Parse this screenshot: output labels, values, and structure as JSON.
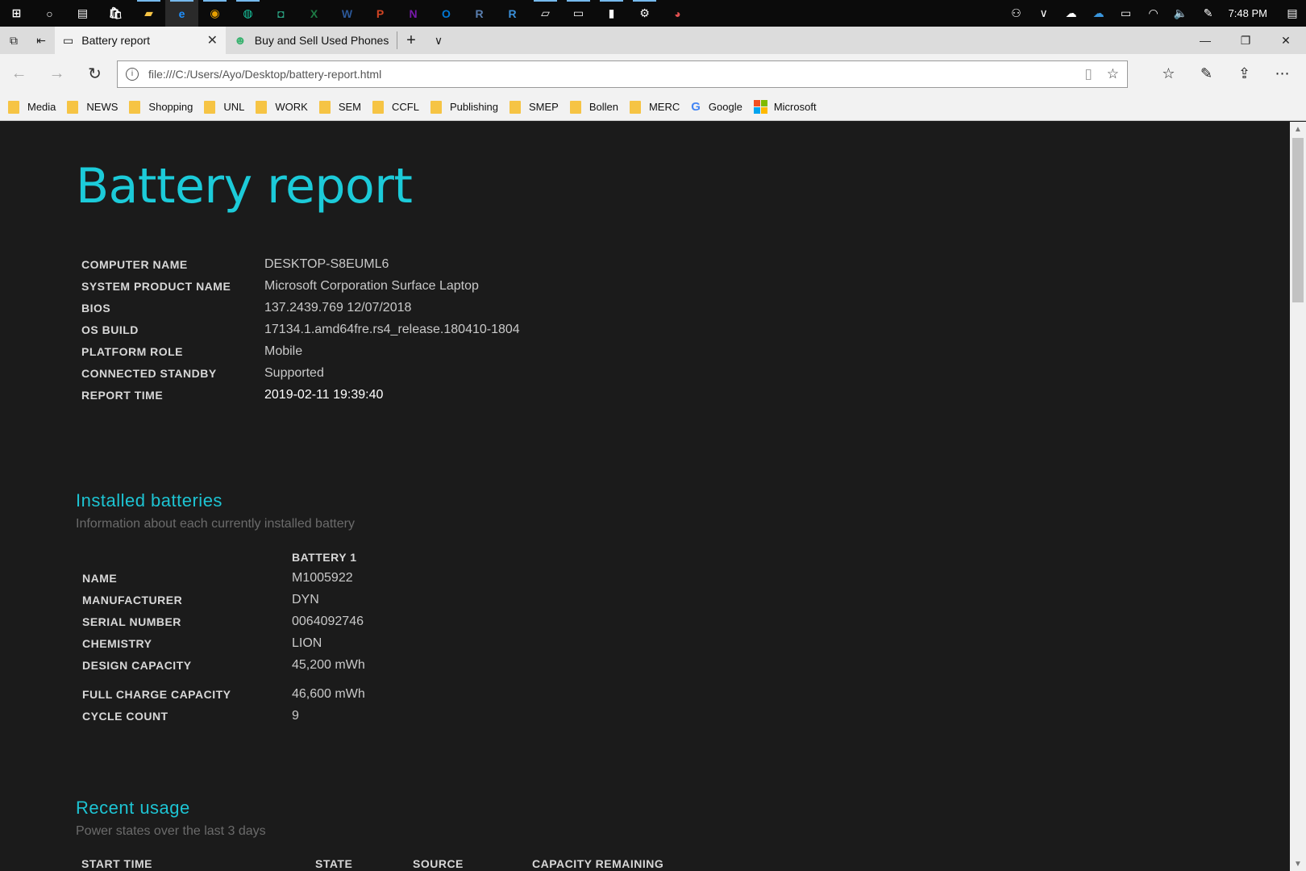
{
  "taskbar": {
    "clock": "7:48 PM",
    "apps": [
      {
        "name": "start-icon",
        "glyph": "⊞",
        "color": "#ffffff"
      },
      {
        "name": "cortana-icon",
        "glyph": "○",
        "color": "#ffffff"
      },
      {
        "name": "task-view-icon",
        "glyph": "▤",
        "color": "#ffffff"
      },
      {
        "name": "store-icon",
        "glyph": "🛍",
        "color": "#ffffff"
      },
      {
        "name": "file-explorer-icon",
        "glyph": "▰",
        "color": "#f6c444"
      },
      {
        "name": "edge-icon",
        "glyph": "e",
        "color": "#1e90ff"
      },
      {
        "name": "chrome-icon",
        "glyph": "◉",
        "color": "#e8a000"
      },
      {
        "name": "globe-app-icon",
        "glyph": "◍",
        "color": "#17c7a0"
      },
      {
        "name": "app-icon",
        "glyph": "◘",
        "color": "#2aa080"
      },
      {
        "name": "excel-icon",
        "glyph": "X",
        "color": "#1d7a44"
      },
      {
        "name": "word-icon",
        "glyph": "W",
        "color": "#2b5797"
      },
      {
        "name": "powerpoint-icon",
        "glyph": "P",
        "color": "#d04423"
      },
      {
        "name": "onenote-icon",
        "glyph": "N",
        "color": "#7719aa"
      },
      {
        "name": "outlook-icon",
        "glyph": "O",
        "color": "#0078d4"
      },
      {
        "name": "r-icon",
        "glyph": "R",
        "color": "#5a7fb0"
      },
      {
        "name": "rstudio-icon",
        "glyph": "R",
        "color": "#3a8fd8"
      },
      {
        "name": "tablet-icon",
        "glyph": "▱",
        "color": "#ffffff"
      },
      {
        "name": "terminal-icon",
        "glyph": "▭",
        "color": "#ffffff"
      },
      {
        "name": "usb-icon",
        "glyph": "▮",
        "color": "#ffffff"
      },
      {
        "name": "settings-icon",
        "glyph": "⚙",
        "color": "#ffffff"
      },
      {
        "name": "paint-icon",
        "glyph": "◕",
        "color": "#e05050"
      }
    ],
    "tray": [
      {
        "name": "people-icon",
        "glyph": "⚇"
      },
      {
        "name": "chevron-up-icon",
        "glyph": "∨"
      },
      {
        "name": "onedrive-white-icon",
        "glyph": "☁"
      },
      {
        "name": "onedrive-blue-icon",
        "glyph": "☁"
      },
      {
        "name": "battery-icon",
        "glyph": "▭"
      },
      {
        "name": "wifi-icon",
        "glyph": "◠"
      },
      {
        "name": "volume-icon",
        "glyph": "🔈"
      },
      {
        "name": "pen-icon",
        "glyph": "✎"
      }
    ],
    "notification_glyph": "▤"
  },
  "tabs": [
    {
      "label": "Battery report",
      "active": true
    },
    {
      "label": "Buy and Sell Used Phones, I",
      "active": false
    }
  ],
  "address": {
    "url": "file:///C:/Users/Ayo/Desktop/battery-report.html"
  },
  "bookmarks": [
    {
      "label": "Media",
      "type": "folder"
    },
    {
      "label": "NEWS",
      "type": "folder"
    },
    {
      "label": "Shopping",
      "type": "folder"
    },
    {
      "label": "UNL",
      "type": "folder"
    },
    {
      "label": "WORK",
      "type": "folder"
    },
    {
      "label": "SEM",
      "type": "folder"
    },
    {
      "label": "CCFL",
      "type": "folder"
    },
    {
      "label": "Publishing",
      "type": "folder"
    },
    {
      "label": "SMEP",
      "type": "folder"
    },
    {
      "label": "Bollen",
      "type": "folder"
    },
    {
      "label": "MERC",
      "type": "folder"
    },
    {
      "label": "Google",
      "type": "google"
    },
    {
      "label": "Microsoft",
      "type": "microsoft"
    }
  ],
  "report": {
    "title": "Battery report",
    "system": [
      {
        "label": "COMPUTER NAME",
        "value": "DESKTOP-S8EUML6"
      },
      {
        "label": "SYSTEM PRODUCT NAME",
        "value": "Microsoft Corporation Surface Laptop"
      },
      {
        "label": "BIOS",
        "value": "137.2439.769 12/07/2018"
      },
      {
        "label": "OS BUILD",
        "value": "17134.1.amd64fre.rs4_release.180410-1804"
      },
      {
        "label": "PLATFORM ROLE",
        "value": "Mobile"
      },
      {
        "label": "CONNECTED STANDBY",
        "value": "Supported"
      },
      {
        "label": "REPORT TIME",
        "value": "2019-02-11  19:39:40"
      }
    ],
    "installed": {
      "title": "Installed batteries",
      "subtitle": "Information about each currently installed battery",
      "column": "BATTERY 1",
      "rows": [
        {
          "label": "NAME",
          "value": "M1005922"
        },
        {
          "label": "MANUFACTURER",
          "value": "DYN"
        },
        {
          "label": "SERIAL NUMBER",
          "value": "0064092746"
        },
        {
          "label": "CHEMISTRY",
          "value": "LION"
        },
        {
          "label": "DESIGN CAPACITY",
          "value": "45,200 mWh"
        },
        {
          "label": "FULL CHARGE CAPACITY",
          "value": "46,600 mWh"
        },
        {
          "label": "CYCLE COUNT",
          "value": "9"
        }
      ]
    },
    "recent": {
      "title": "Recent usage",
      "subtitle": "Power states over the last 3 days",
      "columns": [
        "START TIME",
        "STATE",
        "SOURCE",
        "CAPACITY REMAINING"
      ]
    }
  }
}
